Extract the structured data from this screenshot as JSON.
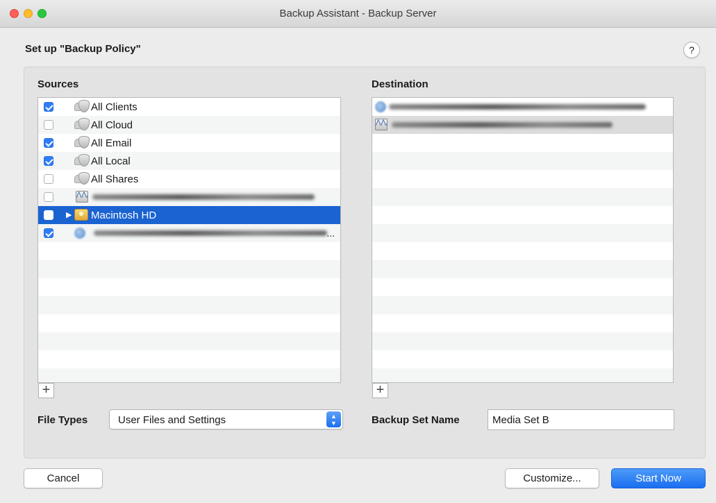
{
  "window": {
    "title": "Backup Assistant - Backup Server"
  },
  "heading": "Set up \"Backup Policy\"",
  "help_label": "?",
  "sources": {
    "label": "Sources",
    "items": [
      {
        "label": "All Clients",
        "checked": true,
        "icon": "group-icon"
      },
      {
        "label": "All Cloud",
        "checked": false,
        "icon": "group-icon"
      },
      {
        "label": "All Email",
        "checked": true,
        "icon": "group-icon"
      },
      {
        "label": "All Local",
        "checked": true,
        "icon": "group-icon"
      },
      {
        "label": "All Shares",
        "checked": false,
        "icon": "group-icon"
      },
      {
        "label": "",
        "checked": false,
        "icon": "server-icon",
        "redacted": true
      },
      {
        "label": "Macintosh HD",
        "checked": false,
        "icon": "disk-icon",
        "selected": true,
        "expandable": true
      },
      {
        "label": "",
        "checked": true,
        "icon": "globe-icon",
        "redacted": true,
        "ellipsis": "..."
      }
    ],
    "add_label": "+"
  },
  "destination": {
    "label": "Destination",
    "items": [
      {
        "label": "",
        "icon": "globe-icon",
        "redacted": true
      },
      {
        "label": "",
        "icon": "server-icon",
        "redacted": true,
        "highlighted": true
      }
    ],
    "add_label": "+"
  },
  "file_types": {
    "label": "File Types",
    "value": "User Files and Settings"
  },
  "backup_set_name": {
    "label": "Backup Set Name",
    "value": "Media Set B"
  },
  "buttons": {
    "cancel": "Cancel",
    "customize": "Customize...",
    "start": "Start Now"
  },
  "colors": {
    "accent": "#1a63d1",
    "button_primary": "#1a6ef0",
    "checkbox_on": "#2f7cf6"
  }
}
